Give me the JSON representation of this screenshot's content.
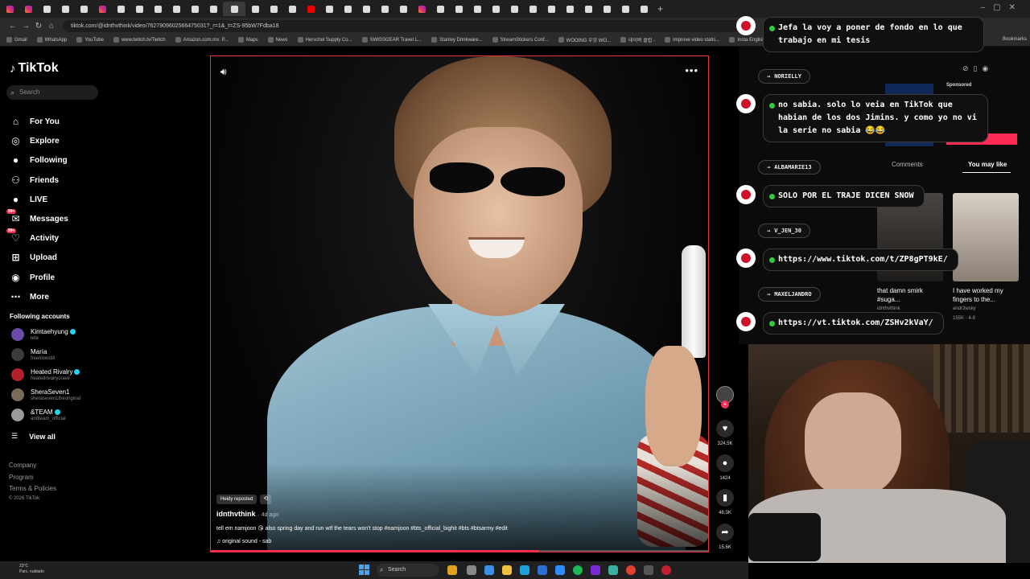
{
  "browser": {
    "url": "tiktok.com/@idnthvthink/video/7627909602566475031?_r=1&_t=ZS-95bW7Fdba18",
    "bookmarks": [
      "Gmail",
      "WhatsApp",
      "YouTube",
      "www.twitch.tv/Twitch",
      "Amazon.com.mx: P...",
      "Maps",
      "News",
      "Herschel Supply Co...",
      "SWISSGEAR Travel L...",
      "Stanley Drinkware...",
      "StreamStickers Conf...",
      "WOOING 우잉 WO...",
      "테이버 클럽 -",
      "Improve video statis...",
      "Insta English Level..."
    ],
    "bookmarks_right": "Bookmarks"
  },
  "sidebar": {
    "logo": "TikTok",
    "search_placeholder": "Search",
    "nav": [
      {
        "label": "For You",
        "icon": "home-icon"
      },
      {
        "label": "Explore",
        "icon": "compass-icon"
      },
      {
        "label": "Following",
        "icon": "following-icon"
      },
      {
        "label": "Friends",
        "icon": "friends-icon"
      },
      {
        "label": "LIVE",
        "icon": "live-icon"
      },
      {
        "label": "Messages",
        "icon": "messages-icon",
        "badge": "99+"
      },
      {
        "label": "Activity",
        "icon": "activity-icon",
        "badge": "99+"
      },
      {
        "label": "Upload",
        "icon": "upload-icon"
      },
      {
        "label": "Profile",
        "icon": "profile-icon"
      },
      {
        "label": "More",
        "icon": "more-icon"
      }
    ],
    "following_title": "Following accounts",
    "accounts": [
      {
        "name": "Kimtaehyung",
        "user": "tete",
        "verified": true
      },
      {
        "name": "María",
        "user": "freelovestill",
        "verified": false
      },
      {
        "name": "Heated Rivalry",
        "user": "heatedrivalrycrave",
        "verified": true
      },
      {
        "name": "SheraSeven1",
        "user": "sheraseven1theoriginal",
        "verified": false
      },
      {
        "name": "&TEAM",
        "user": "andteam_official",
        "verified": true
      }
    ],
    "view_all": "View all",
    "footer": [
      "Company",
      "Program",
      "Terms & Policies"
    ],
    "copyright": "© 2026 TikTok"
  },
  "video": {
    "reposted_label": "Heidy reposted",
    "author": "idnthvthink",
    "age": "· 4d ago",
    "caption": "tell em namjoon 😘 also spring day and run wtf the tears won't stop #namjoon #bts_official_bighit #bts #btsarmy #edit",
    "sound": "♫ original sound - sab",
    "progress": 0.66,
    "likes": "324.5K",
    "comments": "1424",
    "saves": "46.3K",
    "shares": "15.6K"
  },
  "right": {
    "sponsored": "Sponsored",
    "tabs": [
      "Comments",
      "You may like"
    ],
    "cards": [
      {
        "title": "that damn smirk #suga...",
        "user": "idnthvthink"
      },
      {
        "title": "I have worked my fingers to the...",
        "user": "andr3wsky",
        "meta": "155K · 4-8"
      }
    ]
  },
  "chat": [
    {
      "type": "msg",
      "text": "Jefa la voy a poner de fondo en lo que trabajo en mi tesis"
    },
    {
      "type": "user",
      "text": "NORIELLY"
    },
    {
      "type": "msg",
      "text": "no sabia. solo lo veia en TikTok que habian de los dos Jimins. y como yo no vi la serie no sabia 😂😂"
    },
    {
      "type": "user",
      "text": "ALBAMARIE13"
    },
    {
      "type": "msg",
      "text": "SOLO POR EL TRAJE DICEN SNOW"
    },
    {
      "type": "user",
      "text": "V_JEN_30"
    },
    {
      "type": "msg",
      "text": "https://www.tiktok.com/t/ZP8gPT9kE/"
    },
    {
      "type": "user",
      "text": "MAXELJANDRO"
    },
    {
      "type": "msg",
      "text": "https://vt.tiktok.com/ZSHv2kVaY/"
    }
  ],
  "taskbar": {
    "weather_temp": "23°C",
    "weather_desc": "Parc. nublado",
    "search": "Search"
  }
}
